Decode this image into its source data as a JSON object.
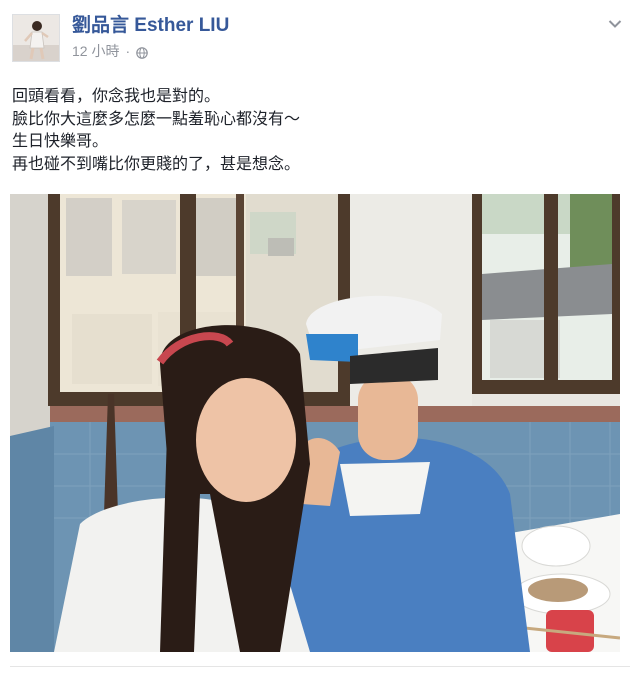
{
  "post": {
    "author_name": "劉品言 Esther LIU",
    "timestamp": "12 小時",
    "privacy_icon": "globe-icon",
    "options_icon": "chevron-down-icon",
    "text_lines": [
      "回頭看看，你念我也是對的。",
      "臉比你大這麼多怎麼一點羞恥心都沒有～",
      "生日快樂哥。",
      "再也碰不到嘴比你更賤的了，甚是想念。"
    ]
  },
  "colors": {
    "author_link": "#365899",
    "meta_text": "#90949c",
    "body_text": "#1d2129"
  }
}
